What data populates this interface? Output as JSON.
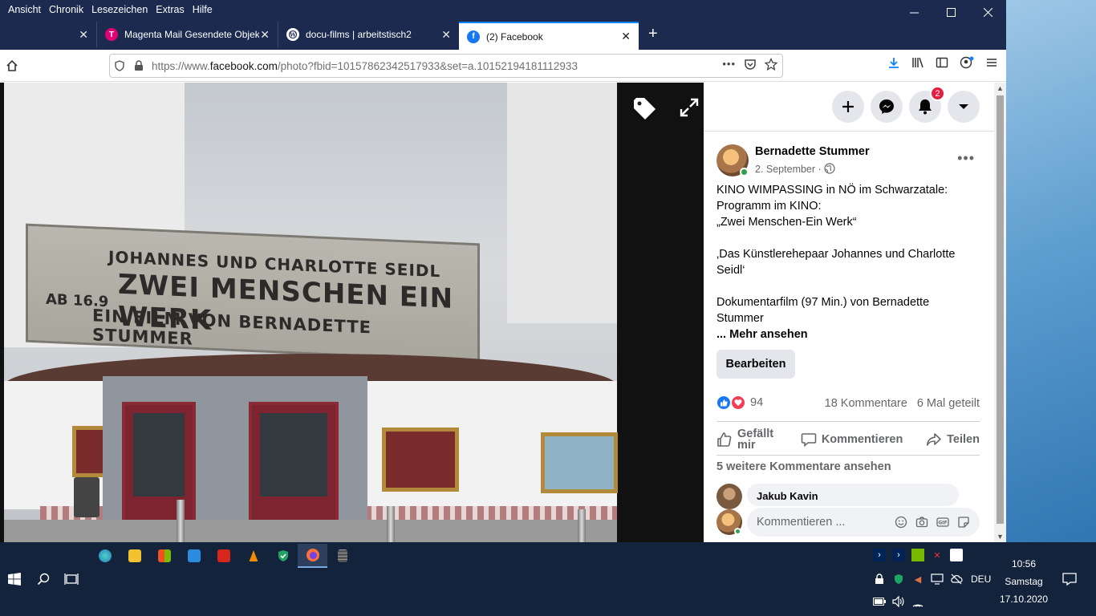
{
  "browser": {
    "menu": [
      "Ansicht",
      "Chronik",
      "Lesezeichen",
      "Extras",
      "Hilfe"
    ],
    "tabs": [
      {
        "label": ""
      },
      {
        "label": "Magenta Mail Gesendete Objekte"
      },
      {
        "label": "docu-films | arbeitstisch2"
      },
      {
        "label": "(2) Facebook"
      }
    ],
    "url_prefix": "https://www.",
    "url_domain": "facebook.com",
    "url_path": "/photo?fbid=10157862342517933&set=a.10152194181112933",
    "new_tab_label": "+",
    "url_more": "•••"
  },
  "photo": {
    "sign_line1": "JOHANNES UND CHARLOTTE SEIDL",
    "sign_line2": "ZWEI MENSCHEN EIN WERK",
    "sign_line3": "EIN FILM VON BERNADETTE STUMMER",
    "sign_age": "AB 16.9"
  },
  "facebook": {
    "notification_count": "2",
    "author": "Bernadette Stummer",
    "date": "2. September",
    "date_sep": " · ",
    "post_lines": [
      "KINO WIMPASSING in NÖ im Schwarzatale:",
      "Programm im KINO:",
      "„Zwei Menschen-Ein Werk“",
      "",
      "‚Das Künstlerehepaar Johannes und Charlotte Seidl‘",
      "",
      "Dokumentarfilm (97 Min.) von Bernadette Stummer"
    ],
    "see_more": "... Mehr ansehen",
    "edit_button": "Bearbeiten",
    "reaction_count": "94",
    "comments_count": "18 Kommentare",
    "shares_count": "6 Mal geteilt",
    "like_action": "Gefällt mir",
    "comment_action": "Kommentieren",
    "share_action": "Teilen",
    "more_comments": "5 weitere Kommentare ansehen",
    "commenter": "Jakub Kavin",
    "composer_placeholder": "Kommentieren ..."
  },
  "taskbar": {
    "language": "DEU",
    "time": "10:56",
    "day": "Samstag",
    "date": "17.10.2020"
  },
  "colors": {
    "firefox_chrome": "#1b2a4e",
    "facebook_blue": "#1877f2",
    "taskbar": "#14233c"
  }
}
